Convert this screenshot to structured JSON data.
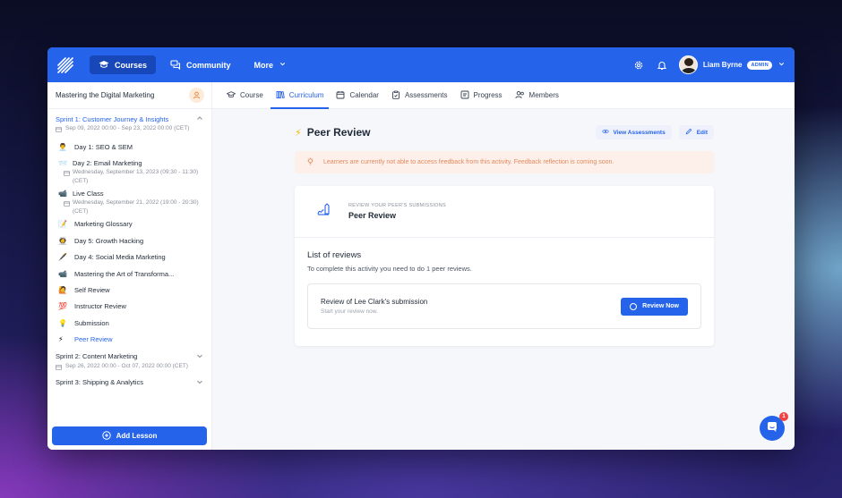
{
  "topbar": {
    "nav": [
      {
        "label": "Courses",
        "icon": "graduation-cap-icon",
        "active": true
      },
      {
        "label": "Community",
        "icon": "chat-icon",
        "active": false
      },
      {
        "label": "More",
        "icon": "chevron-down-icon",
        "active": false
      }
    ],
    "user": {
      "name": "Liam Byrne",
      "badge": "ADMIN"
    }
  },
  "sidebar": {
    "course_title": "Mastering the Digital Marketing",
    "sprints": [
      {
        "title": "Sprint 1: Customer Journey & Insights",
        "date": "Sep 09, 2022 00:00 - Sep 23, 2022 00:00 (CET)"
      },
      {
        "title": "Sprint 2: Content Marketing",
        "date": "Sep 26, 2022 00:00 - Oct 07, 2022 00:00 (CET)"
      },
      {
        "title": "Sprint 3: Shipping & Analytics",
        "date": ""
      }
    ],
    "lessons": [
      {
        "emoji": "👨‍💼",
        "title": "Day 1: SEO & SEM",
        "sub": ""
      },
      {
        "emoji": "📨",
        "title": "Day 2: Email Marketing",
        "sub": "Wednesday, September 13, 2023 (09:30 - 11:30) (CET)"
      },
      {
        "emoji": "📹",
        "title": "Live Class",
        "sub": "Wednesday, September 21, 2022 (19:00 - 20:30) (CET)"
      },
      {
        "emoji": "📝",
        "title": "Marketing Glossary",
        "sub": ""
      },
      {
        "emoji": "👩‍🚀",
        "title": "Day 5: Growth Hacking",
        "sub": ""
      },
      {
        "emoji": "🖋️",
        "title": "Day 4: Social Media Marketing",
        "sub": ""
      },
      {
        "emoji": "📹",
        "title": "Mastering the Art of Transforma...",
        "sub": ""
      },
      {
        "emoji": "🙋",
        "title": "Self Review",
        "sub": ""
      },
      {
        "emoji": "💯",
        "title": "Instructor Review",
        "sub": ""
      },
      {
        "emoji": "💡",
        "title": "Submission",
        "sub": ""
      },
      {
        "emoji": "⚡",
        "title": "Peer Review",
        "sub": ""
      }
    ],
    "add_lesson_label": "Add Lesson"
  },
  "tabs": [
    {
      "label": "Course",
      "icon": "graduation-cap-icon"
    },
    {
      "label": "Curriculum",
      "icon": "books-icon",
      "active": true
    },
    {
      "label": "Calendar",
      "icon": "calendar-icon"
    },
    {
      "label": "Assessments",
      "icon": "clipboard-icon"
    },
    {
      "label": "Progress",
      "icon": "progress-icon"
    },
    {
      "label": "Members",
      "icon": "members-icon"
    }
  ],
  "main": {
    "title": "Peer Review",
    "view_assessments_label": "View Assessments",
    "edit_label": "Edit",
    "alert": "Learners are currently not able to access feedback from this activity. Feedback reflection is coming soon.",
    "activity_eyebrow": "REVIEW YOUR PEER'S SUBMISSIONS",
    "activity_name": "Peer Review",
    "reviews_title": "List of reviews",
    "reviews_desc": "To complete this activity you need to do 1 peer reviews.",
    "review_item": {
      "title": "Review of Lee Clark's submission",
      "sub": "Start your review now.",
      "button": "Review Now"
    }
  },
  "chat": {
    "badge": "1"
  },
  "colors": {
    "accent": "#2563eb",
    "alert_bg": "#fdf0ea",
    "alert_text": "#e08a5d"
  }
}
